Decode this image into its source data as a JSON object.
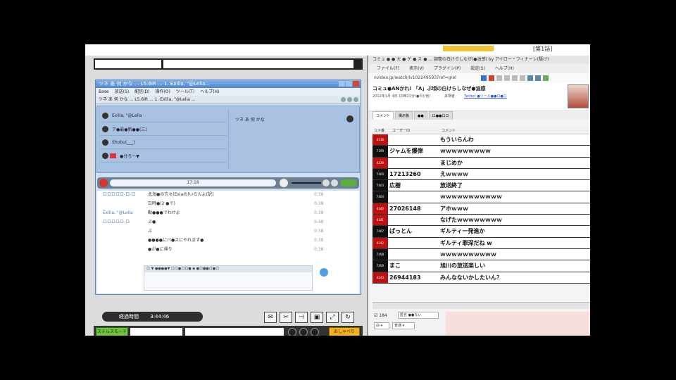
{
  "top_strip": {
    "tag": "[第1話]"
  },
  "player": {
    "window_title": "ツネ あ 何 かな ... L5.6IR ... 1. Exilia, \"@Lelia...",
    "menu": [
      "Base",
      "放送(S)",
      "配信(D)",
      "操作(O)",
      "ツール(T)",
      "ヘルプ(H)"
    ],
    "tab_title": "ツネ あ 何 かな ... L5.6IR ... 1. Exilia, \"@Lelia ...",
    "users": [
      {
        "name": "Exilia, \"@Lelia"
      },
      {
        "name": "ア●最●新●●(三)"
      },
      {
        "name": "Shobu(___)"
      },
      {
        "name": "●分ろー▼"
      }
    ],
    "right_label": "ツネ あ 何 かな",
    "seek_time": "17:18",
    "chat_rows": [
      {
        "who": "ロロロロロ-ロ-ロ",
        "msg": "北海●の方々(Exiaの)いらんよ(訳)",
        "t": "0:38"
      },
      {
        "who": "",
        "msg": "日時●(2 ●で)",
        "t": "0:38"
      },
      {
        "who": "Exilia, \"@Lelia",
        "msg": "動●●●でわけよ",
        "t": "0:38"
      },
      {
        "who": "ロロロロロ-ロ",
        "msg": "ぶ●",
        "t": "0:38"
      },
      {
        "who": "",
        "msg": "ぶ",
        "t": "0:38"
      },
      {
        "who": "",
        "msg": "●●●●にバ●スにやれます●",
        "t": "0:38"
      },
      {
        "who": "",
        "msg": "●が●に帰り",
        "t": "0:38"
      }
    ],
    "input_header": "ロ ▼   ●●●●▼   ロロ●ロロ●   ◆ ●ロ●●ロ●ロ",
    "status_label": "経過時間",
    "status_time": "3:44:46",
    "green_button": "ステルスモード",
    "yellow_button": "おしゃべり"
  },
  "comments_window": {
    "title": "コミュ ● ● 大 ● ゲ ● ス ● ... 調整の白けらしなぜ(●油感) by アイロー・フィナーレ(駆け)",
    "menu": [
      "ファイル(F)",
      "表示(V)",
      "プラグイン(P)",
      "設定(S)",
      "ヘルプ(H)"
    ],
    "url": "nvideo.jp/watch/lv102249593?ref=grel",
    "heading": "コミュ●ANかれ! 「A」ぶ頃の白けらしなぜ●油感",
    "meta": "2012年1月 4日 10時21分(●月)(他)",
    "viewers_label": "来場者",
    "viewers_link": "Twitter ●ツール●●ロ●ロ",
    "tabs": [
      "コメント",
      "掲示板",
      "●●",
      "ロ●●ロロ"
    ],
    "columns": [
      "コメ番",
      "ユーザーID",
      "コメント"
    ],
    "rows": [
      {
        "no": "4338",
        "uid": "",
        "comment": "もういらんわ"
      },
      {
        "no": "7399",
        "uid": "ジャムを爆弾",
        "comment": "ｗｗｗｗｗｗｗｗｗ"
      },
      {
        "no": "4339",
        "uid": "",
        "comment": "まじめか"
      },
      {
        "no": "7400",
        "uid": "17213260",
        "comment": "えｗｗｗｗ"
      },
      {
        "no": "7403",
        "uid": "広樹",
        "comment": "放送終了"
      },
      {
        "no": "7404",
        "uid": "",
        "comment": "ｗｗｗｗｗｗｗｗｗｗｗ"
      },
      {
        "no": "4340",
        "uid": "27026148",
        "comment": "アホｗｗｗ"
      },
      {
        "no": "4341",
        "uid": "",
        "comment": "なげたｗｗｗｗｗｗｗｗ"
      },
      {
        "no": "7407",
        "uid": "ぱっとん",
        "comment": "ギルティー発進か"
      },
      {
        "no": "4342",
        "uid": "",
        "comment": "ギルティ罪深だね w"
      },
      {
        "no": "7408",
        "uid": "",
        "comment": "ｗｗｗｗｗｗｗｗｗｗ"
      },
      {
        "no": "7409",
        "uid": "まこ",
        "comment": "旭川の放送楽しい"
      },
      {
        "no": "4343",
        "uid": "26944183",
        "comment": "みんなないかしたいん？"
      }
    ],
    "footer_check": "☑ 184",
    "footer_select": "匿名 ●●ない",
    "footer_color": "白 ▾",
    "footer_size": "普通 ▾"
  },
  "colors": {
    "accent_red": "#bb1111",
    "player_blue": "#5b87c0",
    "green": "#6fc43a",
    "yellow": "#f4b21c"
  }
}
